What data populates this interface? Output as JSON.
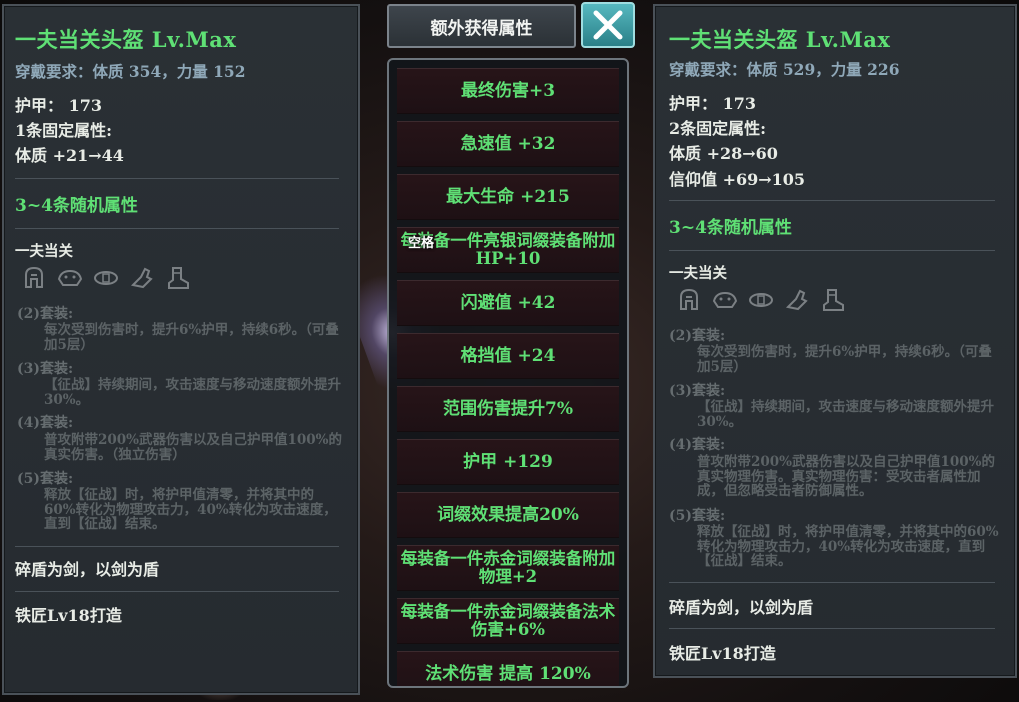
{
  "left": {
    "title": "一夫当关头盔 Lv.Max",
    "requirement": "穿戴要求：体质 354，力量 152",
    "armor": "护甲：  173",
    "fixed_header": "1条固定属性:",
    "fixed_attrs": [
      "体质  +21→44"
    ],
    "random_header": "3~4条随机属性",
    "set_name": "一夫当关",
    "set_icons": [
      "helmet-icon",
      "shoulder-armor-icon",
      "belt-icon",
      "gauntlet-icon",
      "boots-icon"
    ],
    "set_bonuses": [
      {
        "label": "(2)套装:",
        "desc": "每次受到伤害时，提升6%护甲，持续6秒。（可叠加5层）"
      },
      {
        "label": "(3)套装:",
        "desc": "【征战】持续期间，攻击速度与移动速度额外提升30%。"
      },
      {
        "label": "(4)套装:",
        "desc": "普攻附带200%武器伤害以及自己护甲值100%的真实伤害。（独立伤害）"
      },
      {
        "label": "(5)套装:",
        "desc": "释放【征战】时，将护甲值清零，并将其中的60%转化为物理攻击力，40%转化为攻击速度，直到【征战】结束。"
      }
    ],
    "flavor": "碎盾为剑，以剑为盾",
    "crafter": "铁匠Lv18打造"
  },
  "right": {
    "title": "一夫当关头盔 Lv.Max",
    "requirement": "穿戴要求：体质 529，力量 226",
    "armor": "护甲：  173",
    "fixed_header": "2条固定属性:",
    "fixed_attrs": [
      "体质  +28→60",
      "信仰值  +69→105"
    ],
    "random_header": "3~4条随机属性",
    "set_name": "一夫当关",
    "set_icons": [
      "helmet-icon",
      "shoulder-armor-icon",
      "belt-icon",
      "gauntlet-icon",
      "boots-icon"
    ],
    "set_bonuses": [
      {
        "label": "(2)套装:",
        "desc": "每次受到伤害时，提升6%护甲，持续6秒。（可叠加5层）"
      },
      {
        "label": "(3)套装:",
        "desc": "【征战】持续期间，攻击速度与移动速度额外提升30%。"
      },
      {
        "label": "(4)套装:",
        "desc": "普攻附带200%武器伤害以及自己护甲值100%的真实物理伤害。真实物理伤害：受攻击者属性加成，但忽略受击者防御属性。"
      },
      {
        "label": "(5)套装:",
        "desc": "释放【征战】时，将护甲值清零，并将其中的60%转化为物理攻击力，40%转化为攻击速度，直到【征战】结束。"
      }
    ],
    "flavor": "碎盾为剑，以剑为盾",
    "crafter": "铁匠Lv18打造"
  },
  "middle": {
    "header": "额外获得属性",
    "close_icon": "close-icon",
    "space_key": "空格",
    "attributes": [
      "最终伤害+3",
      "急速值 +32",
      "最大生命 +215",
      "每装备一件亮银词缀装备附加HP+10",
      "闪避值 +42",
      "格挡值 +24",
      "范围伤害提升7%",
      "护甲 +129",
      "词缀效果提高20%",
      "每装备一件赤金词缀装备附加物理+2",
      "每装备一件赤金词缀装备法术伤害+6%",
      "法术伤害 提高 120%"
    ]
  },
  "colors": {
    "green": "#5fe075",
    "panel_bg": "#282d32",
    "close_button": "#3f9aa2"
  }
}
